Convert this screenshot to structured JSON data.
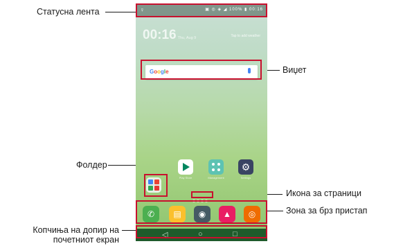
{
  "callouts": {
    "status_bar": "Статусна лента",
    "widget": "Виџет",
    "folder": "Фолдер",
    "page_icon": "Икона за страници",
    "quick_access": "Зона за брз пристап",
    "home_touch_line1": "Копчиња на допир на",
    "home_touch_line2": "почетниот екран"
  },
  "phone": {
    "status_left": "♀",
    "status_right": "▣ ◎ ◈ ◢ 100% ▮ 00:16",
    "clock_time": "00:16",
    "clock_date": "Thu, Aug 9",
    "weather_text": "Tap to add weather",
    "google_label": "Google",
    "apps": {
      "play_label": "Play Store",
      "management_label": "Management",
      "settings_label": "Settings"
    },
    "nav": {
      "back": "◁",
      "home": "○",
      "recent": "□"
    }
  },
  "colors": {
    "highlight": "#c8102e",
    "navbar": "#1e5b2b",
    "phone_call": "#4caf50",
    "messages": "#fbc02d",
    "camera": "#455a64",
    "gallery": "#e91e63",
    "chrome": "#ef6c00"
  }
}
